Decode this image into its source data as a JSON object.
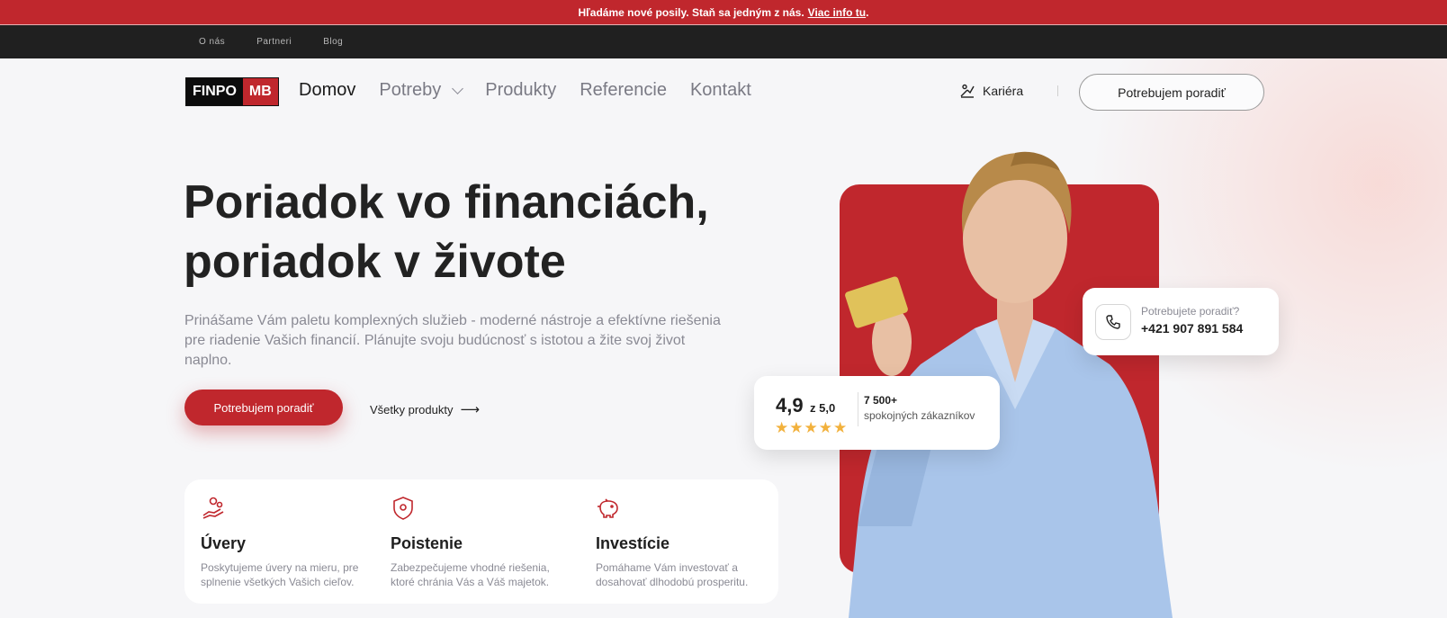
{
  "announcement": {
    "text": "Hľadáme nové posily. Staň sa jedným z nás.",
    "link": "Viac info tu",
    "end": "."
  },
  "topbar": {
    "links": [
      "O nás",
      "Partneri",
      "Blog"
    ]
  },
  "logo": {
    "left": "FINPO",
    "right": "MB"
  },
  "nav": {
    "items": [
      "Domov",
      "Potreby",
      "Produkty",
      "Referencie",
      "Kontakt"
    ],
    "career": "Kariéra",
    "cta": "Potrebujem poradiť"
  },
  "hero": {
    "title_line1": "Poriadok vo financiách,",
    "title_line2": "poriadok v živote",
    "description": "Prinášame Vám paletu komplexných služieb - moderné nástroje a efektívne riešenia pre riadenie Vašich financií. Plánujte svoju budúcnosť s istotou a žite svoj život naplno.",
    "primary_button": "Potrebujem poradiť",
    "secondary_link": "Všetky produkty",
    "arrow": "⟶"
  },
  "services": [
    {
      "title": "Úvery",
      "text": "Poskytujeme úvery na mieru, pre splnenie všetkých Vašich cieľov.",
      "icon": "loan-icon"
    },
    {
      "title": "Poistenie",
      "text": "Zabezpečujeme vhodné riešenia, ktoré chránia Vás a Váš majetok.",
      "icon": "shield-icon"
    },
    {
      "title": "Investície",
      "text": "Pomáhame Vám investovať a dosahovať dlhodobú prosperitu.",
      "icon": "piggy-bank-icon"
    }
  ],
  "contact_card": {
    "question": "Potrebujete poradiť?",
    "phone": "+421 907 891 584"
  },
  "rating_card": {
    "score": "4,9",
    "of": "z 5,0",
    "stars": "★★★★★",
    "count": "7 500+",
    "label": "spokojných zákazníkov"
  },
  "colors": {
    "brand_red": "#c0272d",
    "dark": "#202020",
    "star": "#f2b13c"
  }
}
